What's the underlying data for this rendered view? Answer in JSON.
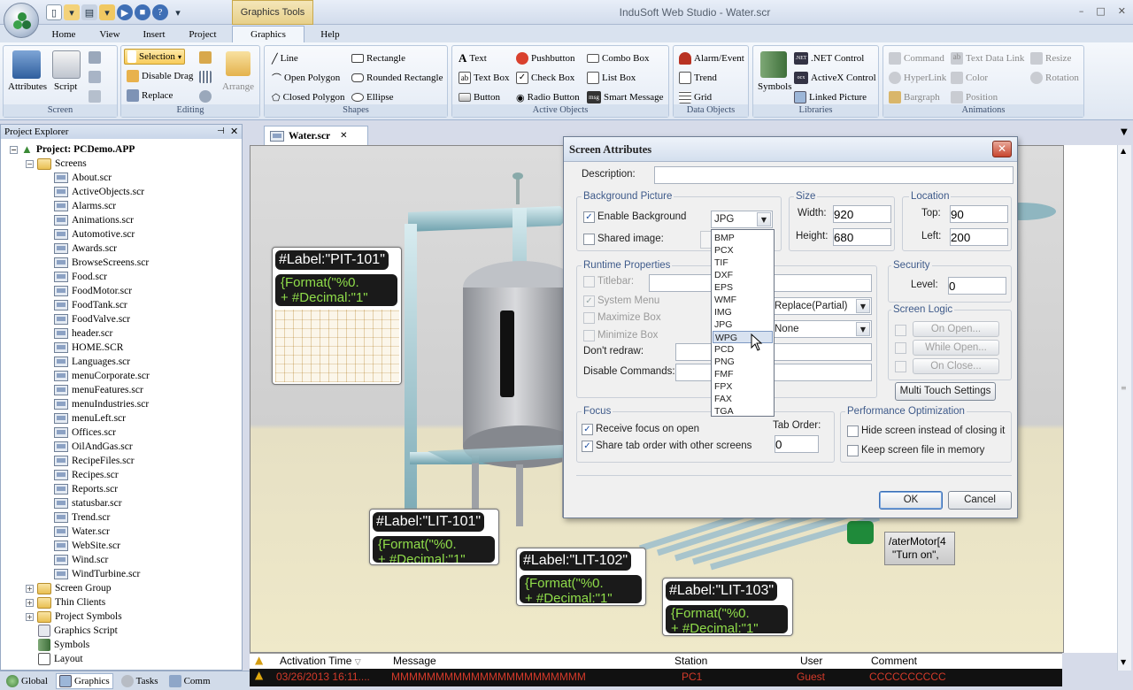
{
  "window": {
    "title": "InduSoft Web Studio - Water.scr",
    "tools_tab": "Graphics Tools",
    "controls": [
      "–",
      "□",
      "✕"
    ]
  },
  "ribbon_tabs": [
    {
      "label": "Home"
    },
    {
      "label": "View"
    },
    {
      "label": "Insert"
    },
    {
      "label": "Project"
    },
    {
      "label": "Graphics",
      "active": true
    },
    {
      "label": "Help"
    }
  ],
  "ribbon": {
    "screen": {
      "label": "Screen",
      "attributes": "Attributes",
      "script": "Script"
    },
    "editing": {
      "label": "Editing",
      "selection": "Selection",
      "disable_drag": "Disable Drag",
      "replace": "Replace",
      "arrange": "Arrange"
    },
    "shapes": {
      "label": "Shapes",
      "line": "Line",
      "open_polygon": "Open Polygon",
      "closed_polygon": "Closed Polygon",
      "rectangle": "Rectangle",
      "rounded_rectangle": "Rounded Rectangle",
      "ellipse": "Ellipse"
    },
    "active_objects": {
      "label": "Active Objects",
      "text": "Text",
      "text_box": "Text Box",
      "button": "Button",
      "pushbutton": "Pushbutton",
      "check_box": "Check Box",
      "radio_button": "Radio Button",
      "combo_box": "Combo Box",
      "list_box": "List Box",
      "smart_message": "Smart Message"
    },
    "data_objects": {
      "label": "Data Objects",
      "alarm_event": "Alarm/Event",
      "trend": "Trend",
      "grid": "Grid"
    },
    "libraries": {
      "label": "Libraries",
      "symbols": "Symbols",
      "net_control": ".NET Control",
      "activex_control": "ActiveX Control",
      "linked_picture": "Linked Picture"
    },
    "animations": {
      "label": "Animations",
      "command": "Command",
      "hyperlink": "HyperLink",
      "bargraph": "Bargraph",
      "text_data_link": "Text Data Link",
      "color": "Color",
      "position": "Position",
      "resize": "Resize",
      "rotation": "Rotation"
    }
  },
  "explorer": {
    "title": "Project Explorer",
    "project": "Project: PCDemo.APP",
    "screens_folder": "Screens",
    "screens": [
      "About.scr",
      "ActiveObjects.scr",
      "Alarms.scr",
      "Animations.scr",
      "Automotive.scr",
      "Awards.scr",
      "BrowseScreens.scr",
      "Food.scr",
      "FoodMotor.scr",
      "FoodTank.scr",
      "FoodValve.scr",
      "header.scr",
      "HOME.SCR",
      "Languages.scr",
      "menuCorporate.scr",
      "menuFeatures.scr",
      "menuIndustries.scr",
      "menuLeft.scr",
      "Offices.scr",
      "OilAndGas.scr",
      "RecipeFiles.scr",
      "Recipes.scr",
      "Reports.scr",
      "statusbar.scr",
      "Trend.scr",
      "Water.scr",
      "WebSite.scr",
      "Wind.scr",
      "WindTurbine.scr"
    ],
    "other_nodes": [
      "Screen Group",
      "Thin Clients",
      "Project Symbols",
      "Graphics Script",
      "Symbols",
      "Layout"
    ]
  },
  "bottom_tabs": [
    {
      "label": "Global"
    },
    {
      "label": "Graphics",
      "active": true
    },
    {
      "label": "Tasks"
    },
    {
      "label": "Comm"
    }
  ],
  "document": {
    "tab": "Water.scr"
  },
  "tags": [
    {
      "name": "#Label:\"PIT-101\"",
      "format": "{Format(\"%0.",
      "decimal": "+ #Decimal:\"1\""
    },
    {
      "name": "#Label:\"LIT-101\"",
      "format": "{Format(\"%0.",
      "decimal": "+ #Decimal:\"1\""
    },
    {
      "name": "#Label:\"LIT-102\"",
      "format": "{Format(\"%0.",
      "decimal": "+ #Decimal:\"1\""
    },
    {
      "name": "#Label:\"LIT-103\"",
      "format": "{Format(\"%0.",
      "decimal": "+ #Decimal:\"1\""
    }
  ],
  "motor_button": {
    "line1": "/aterMotor[4",
    "line2": "\"Turn on\","
  },
  "alarm": {
    "headers": [
      "Activation Time",
      "Message",
      "Station",
      "User",
      "Comment"
    ],
    "row": [
      "03/26/2013 16:11....",
      "MMMMMMMMMMMMMMMMMMMMMM",
      "PC1",
      "Guest",
      "CCCCCCCCCC"
    ]
  },
  "dialog": {
    "title": "Screen Attributes",
    "description_label": "Description:",
    "description_value": "",
    "background": {
      "legend": "Background Picture",
      "enable_label": "Enable Background",
      "enable_checked": true,
      "shared_label": "Shared image:",
      "shared_checked": false,
      "format_value": "JPG"
    },
    "format_options": [
      "BMP",
      "PCX",
      "TIF",
      "DXF",
      "EPS",
      "WMF",
      "IMG",
      "JPG",
      "WPG",
      "PCD",
      "PNG",
      "FMF",
      "FPX",
      "FAX",
      "TGA"
    ],
    "format_highlight": "WPG",
    "size": {
      "legend": "Size",
      "width_label": "Width:",
      "width": "920",
      "height_label": "Height:",
      "height": "680"
    },
    "location": {
      "legend": "Location",
      "top_label": "Top:",
      "top": "90",
      "left_label": "Left:",
      "left": "200"
    },
    "runtime": {
      "legend": "Runtime Properties",
      "titlebar": "Titlebar:",
      "system_menu": "System Menu",
      "maximize_box": "Maximize Box",
      "minimize_box": "Minimize Box",
      "dont_redraw": "Don't redraw:",
      "disable_commands": "Disable Commands:",
      "style_value": "Replace(Partial)",
      "border_value": "None"
    },
    "security": {
      "legend": "Security",
      "level_label": "Level:",
      "level": "0"
    },
    "screen_logic": {
      "legend": "Screen Logic",
      "on_open": "On Open...",
      "while_open": "While Open...",
      "on_close": "On Close..."
    },
    "multi_touch": "Multi Touch Settings",
    "focus": {
      "legend": "Focus",
      "receive": "Receive focus on open",
      "share": "Share tab order with other screens",
      "tab_order_label": "Tab Order:",
      "tab_order": "0"
    },
    "performance": {
      "legend": "Performance Optimization",
      "hide": "Hide screen instead of closing it",
      "keep": "Keep screen file in memory"
    },
    "ok": "OK",
    "cancel": "Cancel"
  }
}
